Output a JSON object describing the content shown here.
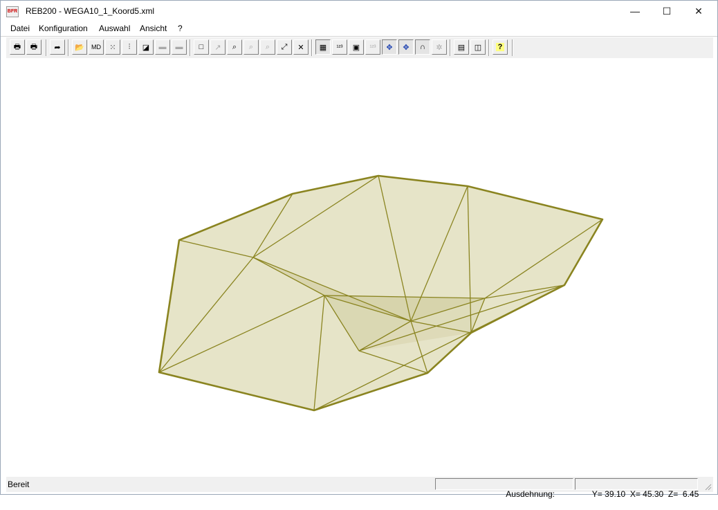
{
  "window": {
    "title": "REB200 - WEGA10_1_Koord5.xml",
    "app_icon_label": "BFR",
    "controls": {
      "minimize": "—",
      "maximize": "☐",
      "close": "✕"
    }
  },
  "menu": {
    "items": [
      "Datei",
      "Konfiguration",
      "Auswahl",
      "Ansicht",
      "?"
    ]
  },
  "toolbar": {
    "buttons": [
      {
        "icon": "print-icon",
        "glyph": "🖶",
        "state": "normal"
      },
      {
        "icon": "print-preview-icon",
        "glyph": "🖶",
        "state": "normal"
      },
      {
        "icon": "export-icon",
        "glyph": "➦",
        "state": "normal"
      },
      {
        "icon": "open-folder-icon",
        "glyph": "📂",
        "state": "normal"
      },
      {
        "icon": "md-icon",
        "glyph": "MD",
        "state": "normal"
      },
      {
        "icon": "points-icon",
        "glyph": "⁙",
        "state": "normal"
      },
      {
        "icon": "profile-icon",
        "glyph": "⫶",
        "state": "normal"
      },
      {
        "icon": "triangle-edit-icon",
        "glyph": "◪",
        "state": "normal"
      },
      {
        "icon": "layer-gray-icon",
        "glyph": "▬",
        "state": "disabled"
      },
      {
        "icon": "layer-gray-2-icon",
        "glyph": "▬",
        "state": "disabled"
      },
      {
        "icon": "rectangle-icon",
        "glyph": "□",
        "state": "normal"
      },
      {
        "icon": "rectangle-arrow-icon",
        "glyph": "↗",
        "state": "disabled"
      },
      {
        "icon": "zoom-m-icon",
        "glyph": "⌕",
        "state": "normal"
      },
      {
        "icon": "zoom-plus-icon",
        "glyph": "⌕",
        "state": "disabled"
      },
      {
        "icon": "zoom-minus-icon",
        "glyph": "⌕",
        "state": "disabled"
      },
      {
        "icon": "zoom-extents-icon",
        "glyph": "⤢",
        "state": "normal"
      },
      {
        "icon": "zoom-center-icon",
        "glyph": "✕",
        "state": "normal"
      },
      {
        "icon": "grid-icon",
        "glyph": "▦",
        "state": "pressed"
      },
      {
        "icon": "point-numbers-icon",
        "glyph": "¹²³",
        "state": "normal"
      },
      {
        "icon": "point-marker-icon",
        "glyph": "▣",
        "state": "normal"
      },
      {
        "icon": "numbers-disabled-icon",
        "glyph": "¹²³",
        "state": "disabled"
      },
      {
        "icon": "rotate-move-icon",
        "glyph": "✥",
        "state": "pressed"
      },
      {
        "icon": "rotate-move-blue-icon",
        "glyph": "✥",
        "state": "pressed"
      },
      {
        "icon": "rotate-arc-icon",
        "glyph": "∩",
        "state": "pressed"
      },
      {
        "icon": "rotate-star-icon",
        "glyph": "✲",
        "state": "disabled"
      },
      {
        "icon": "report-icon",
        "glyph": "▤",
        "state": "normal"
      },
      {
        "icon": "window-icon",
        "glyph": "◫",
        "state": "normal"
      },
      {
        "icon": "help-icon",
        "glyph": "?",
        "state": "normal"
      }
    ]
  },
  "statusbar": {
    "ready": "Bereit",
    "extent_label": "Ausdehnung:",
    "coords": "Y= 39.10  X= 45.30  Z=  6.45"
  },
  "colors": {
    "mesh_fill": "#e6e4c8",
    "mesh_fill_dark": "#cdc99a",
    "mesh_edge": "#8a8420"
  }
}
